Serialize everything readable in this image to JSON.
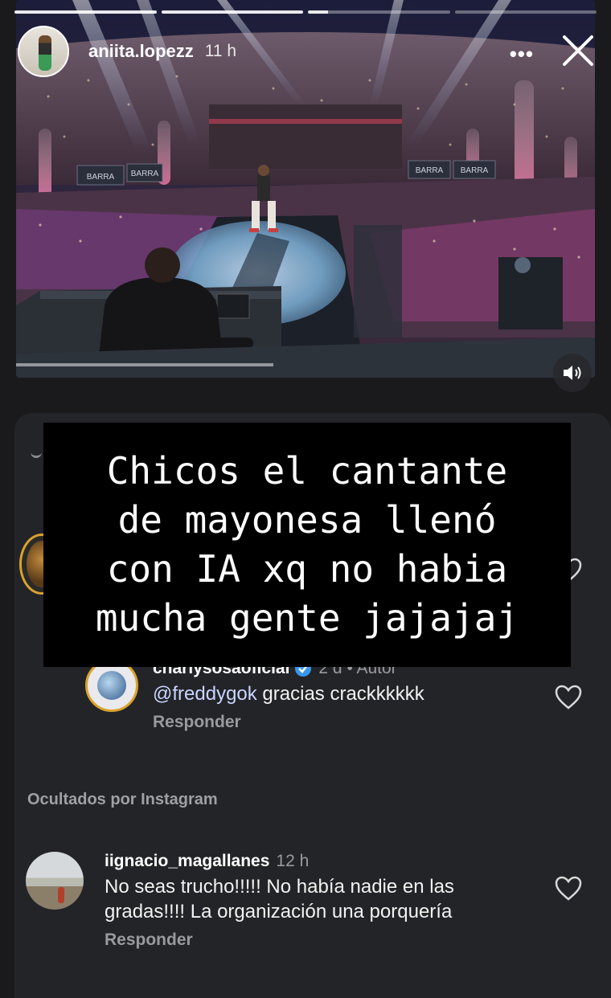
{
  "story": {
    "username": "aniita.lopezz",
    "time": "11 h",
    "more_glyph": "•••",
    "caption": "Chicos el cantante\nde mayonesa llenó\ncon IA xq no habia\nmucha gente jajajaj"
  },
  "photo": {
    "banners": [
      "BARRA",
      "BARRA",
      "BARRA",
      "BARRA"
    ]
  },
  "comments": {
    "reply_comment": {
      "username": "charlysosaoficial",
      "meta": "2 d • Autor",
      "mention": "@freddygok",
      "text": " gracias crackkkkkk",
      "reply_label": "Responder"
    },
    "hidden_section_label": "Ocultados por Instagram",
    "hidden_comment": {
      "username": "iignacio_magallanes",
      "meta": "12 h",
      "text": "No seas trucho!!!!! No había nadie en las gradas!!!! La organización una porquería",
      "reply_label": "Responder"
    }
  },
  "colors": {
    "background": "#1a1a1d",
    "sheet": "#232428",
    "verified": "#3897f0",
    "story_ring": "#d9a22b"
  }
}
